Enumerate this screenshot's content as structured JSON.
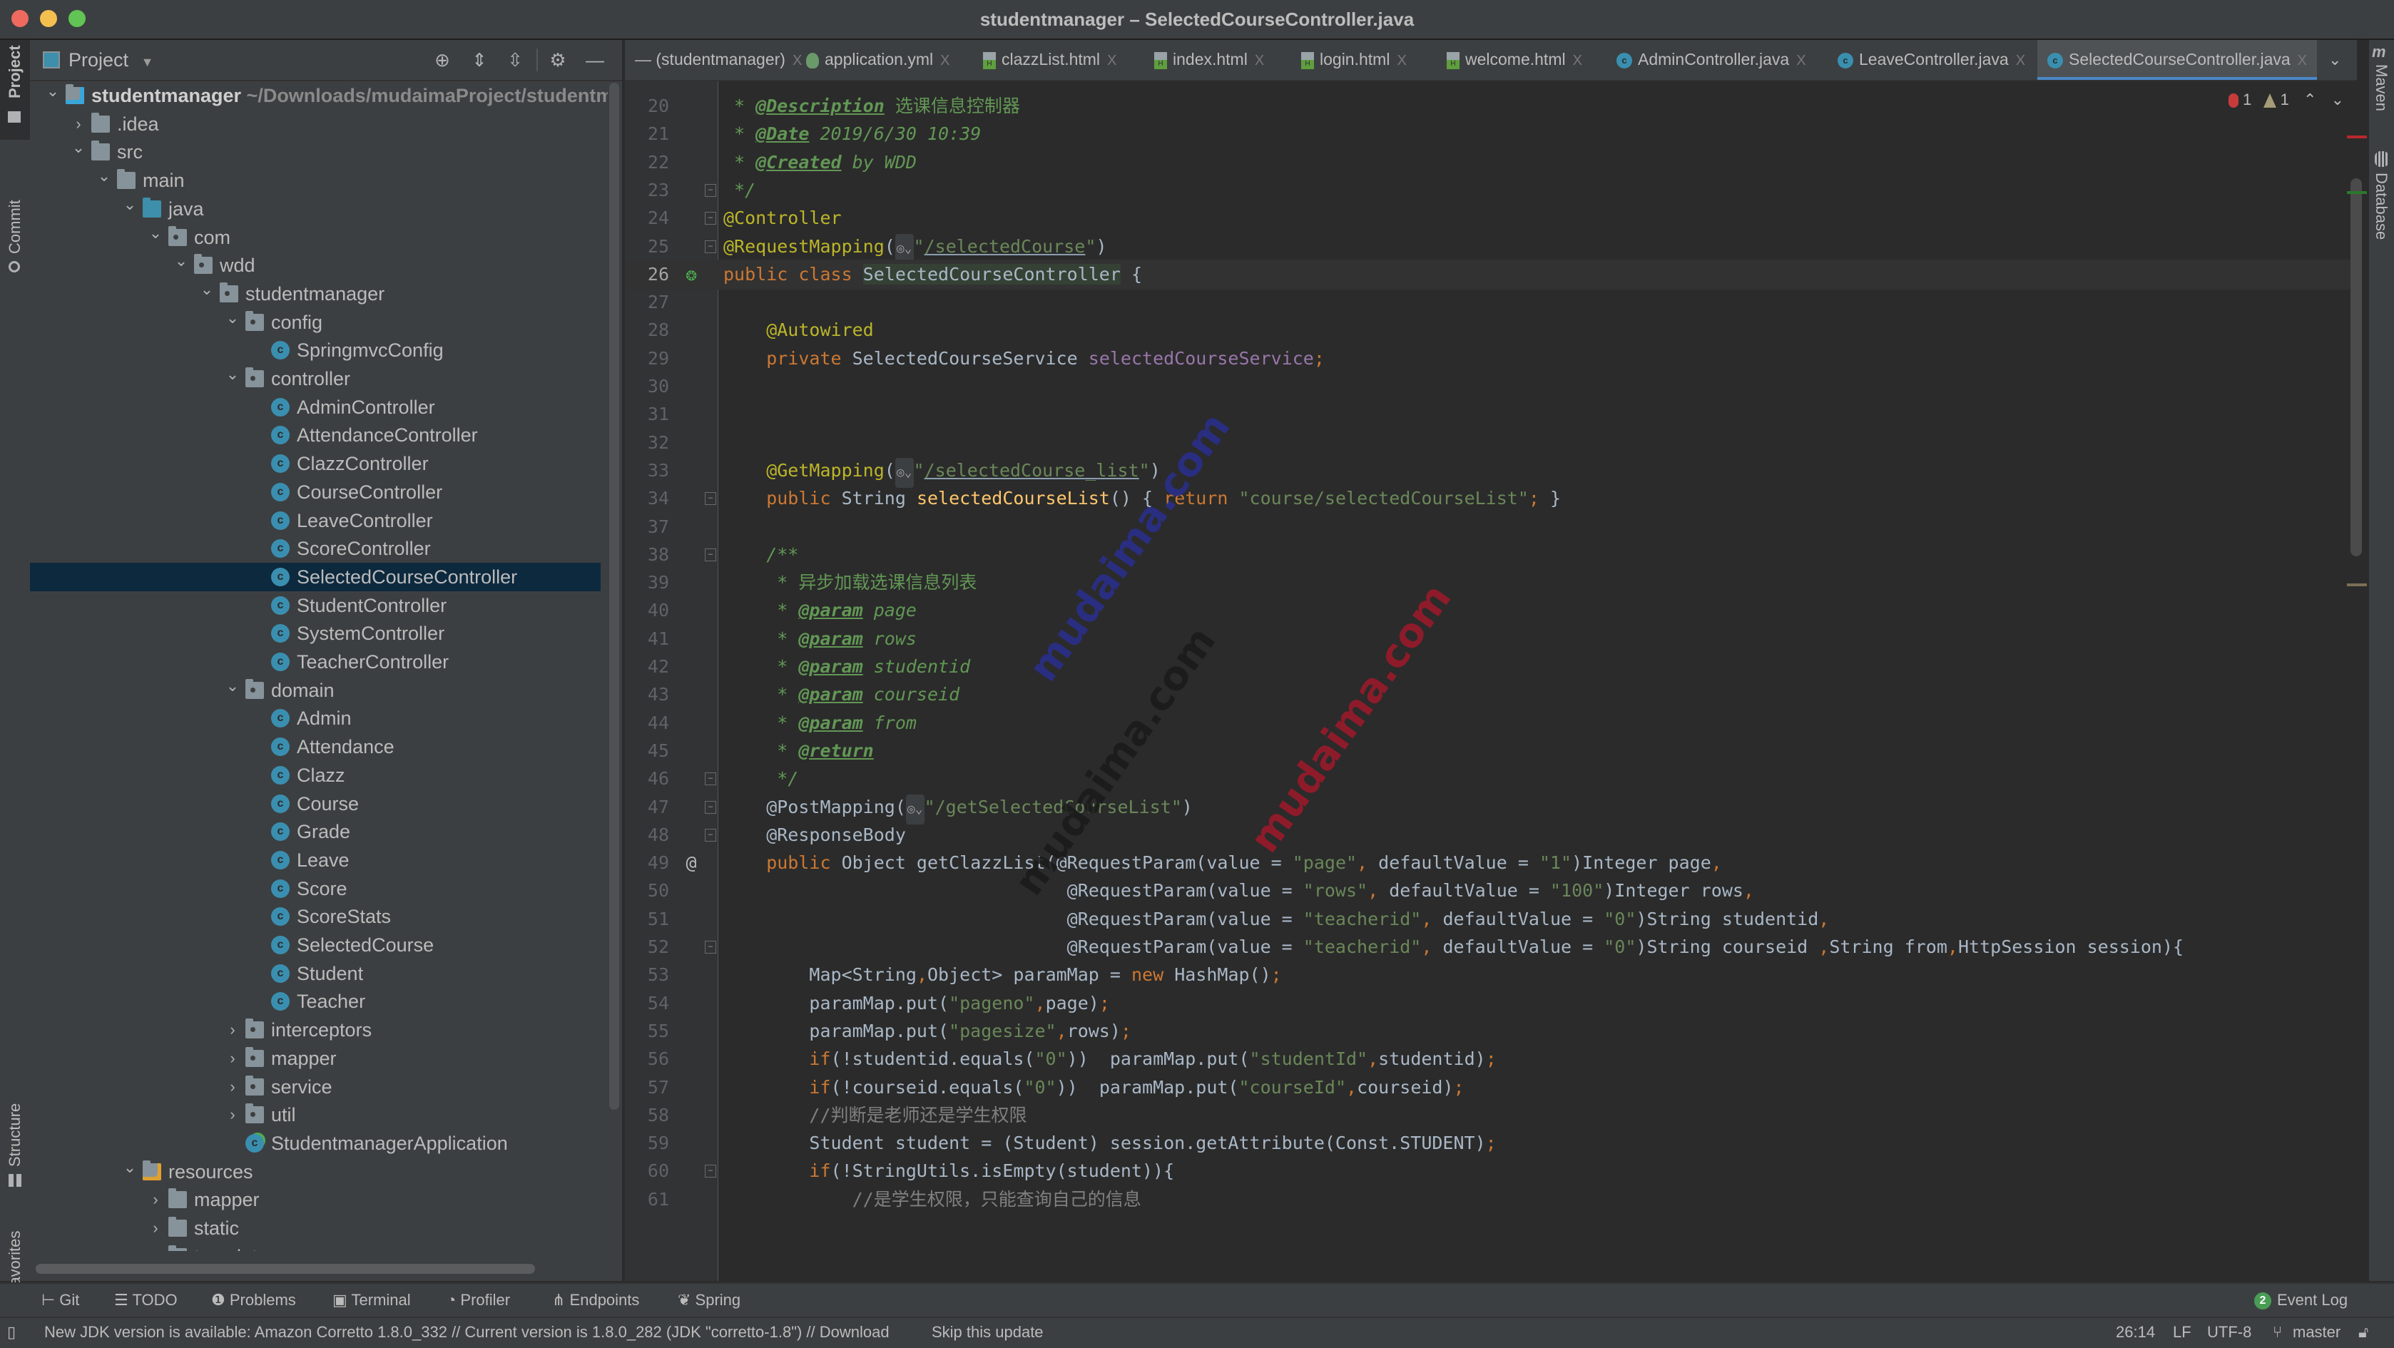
{
  "window": {
    "title": "studentmanager – SelectedCourseController.java"
  },
  "left_strip": {
    "items": [
      {
        "label": "Project",
        "icon": "folder-icon"
      },
      {
        "label": "Commit",
        "icon": "commit-icon"
      },
      {
        "label": "Structure",
        "icon": "structure-icon"
      },
      {
        "label": "Favorites",
        "icon": "star-icon"
      }
    ]
  },
  "right_strip": {
    "items": [
      {
        "label": "Maven",
        "icon": "maven-icon"
      },
      {
        "label": "Database",
        "icon": "database-icon"
      }
    ]
  },
  "project_panel": {
    "title": "Project",
    "toolbar_icons": [
      "locate-icon",
      "expand-all-icon",
      "collapse-all-icon",
      "gear-icon",
      "hide-icon"
    ],
    "tree": [
      {
        "depth": 0,
        "label": "studentmanager",
        "suffix": "~/Downloads/mudaimaProject/studentm",
        "icon": "module",
        "arrow": "down",
        "bold": true
      },
      {
        "depth": 1,
        "label": ".idea",
        "icon": "folder",
        "arrow": "right"
      },
      {
        "depth": 1,
        "label": "src",
        "icon": "folder",
        "arrow": "down"
      },
      {
        "depth": 2,
        "label": "main",
        "icon": "folder",
        "arrow": "down"
      },
      {
        "depth": 3,
        "label": "java",
        "icon": "source-folder",
        "arrow": "down"
      },
      {
        "depth": 4,
        "label": "com",
        "icon": "package",
        "arrow": "down"
      },
      {
        "depth": 5,
        "label": "wdd",
        "icon": "package",
        "arrow": "down"
      },
      {
        "depth": 6,
        "label": "studentmanager",
        "icon": "package",
        "arrow": "down"
      },
      {
        "depth": 7,
        "label": "config",
        "icon": "package",
        "arrow": "down"
      },
      {
        "depth": 8,
        "label": "SpringmvcConfig",
        "icon": "class"
      },
      {
        "depth": 7,
        "label": "controller",
        "icon": "package",
        "arrow": "down"
      },
      {
        "depth": 8,
        "label": "AdminController",
        "icon": "class"
      },
      {
        "depth": 8,
        "label": "AttendanceController",
        "icon": "class"
      },
      {
        "depth": 8,
        "label": "ClazzController",
        "icon": "class"
      },
      {
        "depth": 8,
        "label": "CourseController",
        "icon": "class"
      },
      {
        "depth": 8,
        "label": "LeaveController",
        "icon": "class"
      },
      {
        "depth": 8,
        "label": "ScoreController",
        "icon": "class"
      },
      {
        "depth": 8,
        "label": "SelectedCourseController",
        "icon": "class",
        "selected": true
      },
      {
        "depth": 8,
        "label": "StudentController",
        "icon": "class"
      },
      {
        "depth": 8,
        "label": "SystemController",
        "icon": "class"
      },
      {
        "depth": 8,
        "label": "TeacherController",
        "icon": "class"
      },
      {
        "depth": 7,
        "label": "domain",
        "icon": "package",
        "arrow": "down"
      },
      {
        "depth": 8,
        "label": "Admin",
        "icon": "class"
      },
      {
        "depth": 8,
        "label": "Attendance",
        "icon": "class"
      },
      {
        "depth": 8,
        "label": "Clazz",
        "icon": "class"
      },
      {
        "depth": 8,
        "label": "Course",
        "icon": "class"
      },
      {
        "depth": 8,
        "label": "Grade",
        "icon": "class"
      },
      {
        "depth": 8,
        "label": "Leave",
        "icon": "class"
      },
      {
        "depth": 8,
        "label": "Score",
        "icon": "class"
      },
      {
        "depth": 8,
        "label": "ScoreStats",
        "icon": "class"
      },
      {
        "depth": 8,
        "label": "SelectedCourse",
        "icon": "class"
      },
      {
        "depth": 8,
        "label": "Student",
        "icon": "class"
      },
      {
        "depth": 8,
        "label": "Teacher",
        "icon": "class"
      },
      {
        "depth": 7,
        "label": "interceptors",
        "icon": "package",
        "arrow": "right"
      },
      {
        "depth": 7,
        "label": "mapper",
        "icon": "package",
        "arrow": "right"
      },
      {
        "depth": 7,
        "label": "service",
        "icon": "package",
        "arrow": "right"
      },
      {
        "depth": 7,
        "label": "util",
        "icon": "package",
        "arrow": "right"
      },
      {
        "depth": 7,
        "label": "StudentmanagerApplication",
        "icon": "spring-class"
      },
      {
        "depth": 3,
        "label": "resources",
        "icon": "resources-folder",
        "arrow": "down"
      },
      {
        "depth": 4,
        "label": "mapper",
        "icon": "folder",
        "arrow": "right"
      },
      {
        "depth": 4,
        "label": "static",
        "icon": "folder",
        "arrow": "right"
      },
      {
        "depth": 4,
        "label": "templates",
        "icon": "folder",
        "arrow": "down"
      }
    ]
  },
  "tabs": [
    {
      "label": "(studentmanager)",
      "icon": "none",
      "active": false
    },
    {
      "label": "application.yml",
      "icon": "yml",
      "active": false
    },
    {
      "label": "clazzList.html",
      "icon": "html",
      "active": false
    },
    {
      "label": "index.html",
      "icon": "html",
      "active": false
    },
    {
      "label": "login.html",
      "icon": "html",
      "active": false
    },
    {
      "label": "welcome.html",
      "icon": "html",
      "active": false
    },
    {
      "label": "AdminController.java",
      "icon": "java",
      "active": false
    },
    {
      "label": "LeaveController.java",
      "icon": "java",
      "active": false
    },
    {
      "label": "SelectedCourseController.java",
      "icon": "java",
      "active": true
    }
  ],
  "tab_close_glyph": "X",
  "inspection": {
    "errors": "1",
    "warnings": "1"
  },
  "editor": {
    "lines": [
      {
        "n": "20",
        "tokens": [
          [
            "doc",
            " * "
          ],
          [
            "doctag",
            "@Description"
          ],
          [
            "docplain",
            " 选课信息控制器"
          ]
        ]
      },
      {
        "n": "21",
        "tokens": [
          [
            "doc",
            " * "
          ],
          [
            "doctag",
            "@Date"
          ],
          [
            "doc",
            " 2019/6/30 10:39"
          ]
        ]
      },
      {
        "n": "22",
        "tokens": [
          [
            "doc",
            " * "
          ],
          [
            "doctag",
            "@Created"
          ],
          [
            "doc",
            " by WDD"
          ]
        ]
      },
      {
        "n": "23",
        "fold": true,
        "tokens": [
          [
            "doc",
            " */"
          ]
        ]
      },
      {
        "n": "24",
        "fold": true,
        "tokens": [
          [
            "ann",
            "@Controller"
          ]
        ]
      },
      {
        "n": "25",
        "fold": true,
        "tokens": [
          [
            "ann",
            "@RequestMapping"
          ],
          [
            "plain",
            "("
          ],
          [
            "globe",
            "◎⌄"
          ],
          [
            "str",
            "\""
          ],
          [
            "url",
            "/selectedCourse"
          ],
          [
            "str",
            "\""
          ],
          [
            "plain",
            ")"
          ]
        ]
      },
      {
        "n": "26",
        "current": true,
        "mark": "spring-bean-icon",
        "tokens": [
          [
            "kw",
            "public class "
          ],
          [
            "sel",
            "SelectedCourseController"
          ],
          [
            "plain",
            " {"
          ]
        ]
      },
      {
        "n": "27",
        "tokens": []
      },
      {
        "n": "28",
        "tokens": [
          [
            "ann",
            "    @Autowired"
          ]
        ]
      },
      {
        "n": "29",
        "tokens": [
          [
            "kw",
            "    private "
          ],
          [
            "plain",
            "SelectedCourseService "
          ],
          [
            "fld",
            "selectedCourseService"
          ],
          [
            "kw",
            ";"
          ]
        ]
      },
      {
        "n": "30",
        "tokens": []
      },
      {
        "n": "31",
        "tokens": []
      },
      {
        "n": "32",
        "tokens": []
      },
      {
        "n": "33",
        "tokens": [
          [
            "ann",
            "    @GetMapping"
          ],
          [
            "plain",
            "("
          ],
          [
            "globe",
            "◎⌄"
          ],
          [
            "str",
            "\""
          ],
          [
            "url",
            "/selectedCourse_list"
          ],
          [
            "str",
            "\""
          ],
          [
            "plain",
            ")"
          ]
        ]
      },
      {
        "n": "34",
        "fold": true,
        "tokens": [
          [
            "kw",
            "    public "
          ],
          [
            "plain",
            "String "
          ],
          [
            "mth",
            "selectedCourseList"
          ],
          [
            "plain",
            "() { "
          ],
          [
            "kw",
            "return "
          ],
          [
            "str",
            "\"course/selectedCourseList\""
          ],
          [
            "kw",
            ";"
          ],
          [
            "plain",
            " }"
          ]
        ]
      },
      {
        "n": "37",
        "tokens": []
      },
      {
        "n": "38",
        "fold": true,
        "tokens": [
          [
            "doc",
            "    /**"
          ]
        ]
      },
      {
        "n": "39",
        "tokens": [
          [
            "docplain",
            "     * 异步加载选课信息列表"
          ]
        ]
      },
      {
        "n": "40",
        "tokens": [
          [
            "doc",
            "     * "
          ],
          [
            "doctag",
            "@param"
          ],
          [
            "doc",
            " page"
          ]
        ]
      },
      {
        "n": "41",
        "tokens": [
          [
            "doc",
            "     * "
          ],
          [
            "doctag",
            "@param"
          ],
          [
            "doc",
            " rows"
          ]
        ]
      },
      {
        "n": "42",
        "tokens": [
          [
            "doc",
            "     * "
          ],
          [
            "doctag",
            "@param"
          ],
          [
            "doc",
            " studentid"
          ]
        ]
      },
      {
        "n": "43",
        "tokens": [
          [
            "doc",
            "     * "
          ],
          [
            "doctag",
            "@param"
          ],
          [
            "doc",
            " courseid"
          ]
        ]
      },
      {
        "n": "44",
        "tokens": [
          [
            "doc",
            "     * "
          ],
          [
            "doctag",
            "@param"
          ],
          [
            "doc",
            " from"
          ]
        ]
      },
      {
        "n": "45",
        "tokens": [
          [
            "doc",
            "     * "
          ],
          [
            "doctag",
            "@return"
          ]
        ]
      },
      {
        "n": "46",
        "fold": true,
        "tokens": [
          [
            "doc",
            "     */"
          ]
        ]
      },
      {
        "n": "47",
        "fold": true,
        "tokens": [
          [
            "plain",
            "    @PostMapping("
          ],
          [
            "globe",
            "◎⌄"
          ],
          [
            "str",
            "\"/getSelectedCourseList\""
          ],
          [
            "plain",
            ")"
          ]
        ]
      },
      {
        "n": "48",
        "fold": true,
        "tokens": [
          [
            "plain",
            "    @ResponseBody"
          ]
        ]
      },
      {
        "n": "49",
        "mark": "at-icon",
        "tokens": [
          [
            "kw",
            "    public "
          ],
          [
            "plain",
            "Object getClazzList(@RequestParam(value = "
          ],
          [
            "str",
            "\"page\""
          ],
          [
            "kw",
            ", "
          ],
          [
            "plain",
            "defaultValue = "
          ],
          [
            "str",
            "\"1\""
          ],
          [
            "plain",
            ")Integer page"
          ],
          [
            "kw",
            ","
          ]
        ]
      },
      {
        "n": "50",
        "tokens": [
          [
            "plain",
            "                                @RequestParam(value = "
          ],
          [
            "str",
            "\"rows\""
          ],
          [
            "kw",
            ", "
          ],
          [
            "plain",
            "defaultValue = "
          ],
          [
            "str",
            "\"100\""
          ],
          [
            "plain",
            ")Integer rows"
          ],
          [
            "kw",
            ","
          ]
        ]
      },
      {
        "n": "51",
        "tokens": [
          [
            "plain",
            "                                @RequestParam(value = "
          ],
          [
            "str",
            "\"teacherid\""
          ],
          [
            "kw",
            ", "
          ],
          [
            "plain",
            "defaultValue = "
          ],
          [
            "str",
            "\"0\""
          ],
          [
            "plain",
            ")String studentid"
          ],
          [
            "kw",
            ","
          ]
        ]
      },
      {
        "n": "52",
        "fold": true,
        "tokens": [
          [
            "plain",
            "                                @RequestParam(value = "
          ],
          [
            "str",
            "\"teacherid\""
          ],
          [
            "kw",
            ", "
          ],
          [
            "plain",
            "defaultValue = "
          ],
          [
            "str",
            "\"0\""
          ],
          [
            "plain",
            ")String courseid "
          ],
          [
            "kw",
            ","
          ],
          [
            "plain",
            "String from"
          ],
          [
            "kw",
            ","
          ],
          [
            "plain",
            "HttpSession session){"
          ]
        ]
      },
      {
        "n": "53",
        "tokens": [
          [
            "plain",
            "        Map<String"
          ],
          [
            "kw",
            ","
          ],
          [
            "plain",
            "Object> paramMap = "
          ],
          [
            "kw",
            "new "
          ],
          [
            "plain",
            "HashMap()"
          ],
          [
            "kw",
            ";"
          ]
        ]
      },
      {
        "n": "54",
        "tokens": [
          [
            "plain",
            "        paramMap.put("
          ],
          [
            "str",
            "\"pageno\""
          ],
          [
            "kw",
            ","
          ],
          [
            "plain",
            "page)"
          ],
          [
            "kw",
            ";"
          ]
        ]
      },
      {
        "n": "55",
        "tokens": [
          [
            "plain",
            "        paramMap.put("
          ],
          [
            "str",
            "\"pagesize\""
          ],
          [
            "kw",
            ","
          ],
          [
            "plain",
            "rows)"
          ],
          [
            "kw",
            ";"
          ]
        ]
      },
      {
        "n": "56",
        "tokens": [
          [
            "kw",
            "        if"
          ],
          [
            "plain",
            "(!studentid.equals("
          ],
          [
            "str",
            "\"0\""
          ],
          [
            "plain",
            "))  paramMap.put("
          ],
          [
            "str",
            "\"studentId\""
          ],
          [
            "kw",
            ","
          ],
          [
            "plain",
            "studentid)"
          ],
          [
            "kw",
            ";"
          ]
        ]
      },
      {
        "n": "57",
        "tokens": [
          [
            "kw",
            "        if"
          ],
          [
            "plain",
            "(!courseid.equals("
          ],
          [
            "str",
            "\"0\""
          ],
          [
            "plain",
            "))  paramMap.put("
          ],
          [
            "str",
            "\"courseId\""
          ],
          [
            "kw",
            ","
          ],
          [
            "plain",
            "courseid)"
          ],
          [
            "kw",
            ";"
          ]
        ]
      },
      {
        "n": "58",
        "tokens": [
          [
            "cmt",
            "        //判断是老师还是学生权限"
          ]
        ]
      },
      {
        "n": "59",
        "tokens": [
          [
            "plain",
            "        Student student = (Student) session.getAttribute(Const.STUDENT)"
          ],
          [
            "kw",
            ";"
          ]
        ]
      },
      {
        "n": "60",
        "fold": true,
        "tokens": [
          [
            "kw",
            "        if"
          ],
          [
            "plain",
            "(!StringUtils.isEmpty(student)){"
          ]
        ]
      },
      {
        "n": "61",
        "tokens": [
          [
            "cmt",
            "            //是学生权限，只能查询自己的信息"
          ]
        ]
      }
    ]
  },
  "watermarks": [
    {
      "text": "mudaima.com",
      "color": "#2a2f8f"
    },
    {
      "text": "mudaima.com",
      "color": "#1a1a1a"
    },
    {
      "text": "mudaima.com",
      "color": "#a0192a"
    }
  ],
  "tool_windows": [
    {
      "label": "Git",
      "icon": "git-icon"
    },
    {
      "label": "TODO",
      "icon": "list-icon"
    },
    {
      "label": "Problems",
      "icon": "problems-icon"
    },
    {
      "label": "Terminal",
      "icon": "terminal-icon"
    },
    {
      "label": "Profiler",
      "icon": "profiler-icon"
    },
    {
      "label": "Endpoints",
      "icon": "endpoints-icon"
    },
    {
      "label": "Spring",
      "icon": "spring-icon"
    }
  ],
  "event_log": {
    "label": "Event Log",
    "count": "2"
  },
  "status": {
    "message": "New JDK version is available: Amazon Corretto 1.8.0_332 // Current version is 1.8.0_282 (JDK \"corretto-1.8\") // Download",
    "skip": "Skip this update",
    "position": "26:14",
    "line_sep": "LF",
    "encoding": "UTF-8",
    "branch": "master"
  },
  "colors": {
    "accent": "#4a88c7",
    "selection": "#0d293e",
    "class_icon": "#3a8fb0",
    "error": "#c73b3b",
    "badge": "#499c54"
  }
}
